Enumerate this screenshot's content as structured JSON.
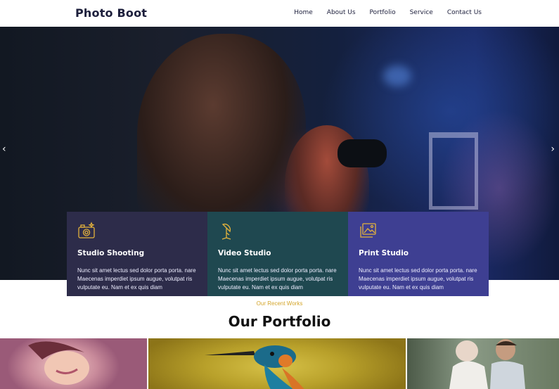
{
  "site": {
    "brand": "Photo Boot"
  },
  "nav": {
    "items": [
      {
        "label": "Home"
      },
      {
        "label": "About Us"
      },
      {
        "label": "Portfolio"
      },
      {
        "label": "Service"
      },
      {
        "label": "Contact Us"
      }
    ]
  },
  "slider": {
    "prev_icon": "chevron-left-icon",
    "next_icon": "chevron-right-icon",
    "prev_glyph": "‹",
    "next_glyph": "›"
  },
  "features": [
    {
      "title": "Studio Shooting",
      "icon": "camera-icon",
      "text": "Nunc sit amet lectus sed dolor porta porta. nare Maecenas imperdiet ipsum augue, volutpat ris vulputate eu. Nam et ex quis diam",
      "bg": "#2d2c4a"
    },
    {
      "title": "Video Studio",
      "icon": "lamp-icon",
      "text": "Nunc sit amet lectus sed dolor porta porta. nare Maecenas imperdiet ipsum augue, volutpat ris vulputate eu. Nam et ex quis diam",
      "bg": "#1f4850"
    },
    {
      "title": "Print Studio",
      "icon": "photo-print-icon",
      "text": "Nunc sit amet lectus sed dolor porta porta. nare Maecenas imperdiet ipsum augue, volutpat ris vulputate eu. Nam et ex quis diam",
      "bg": "#3e3f92"
    }
  ],
  "portfolio": {
    "eyebrow": "Our Recent Works",
    "title": "Our Portfolio"
  },
  "colors": {
    "accent": "#d4a52a",
    "icon_gold": "#e3b23c",
    "brand_text": "#1d1f3c"
  }
}
